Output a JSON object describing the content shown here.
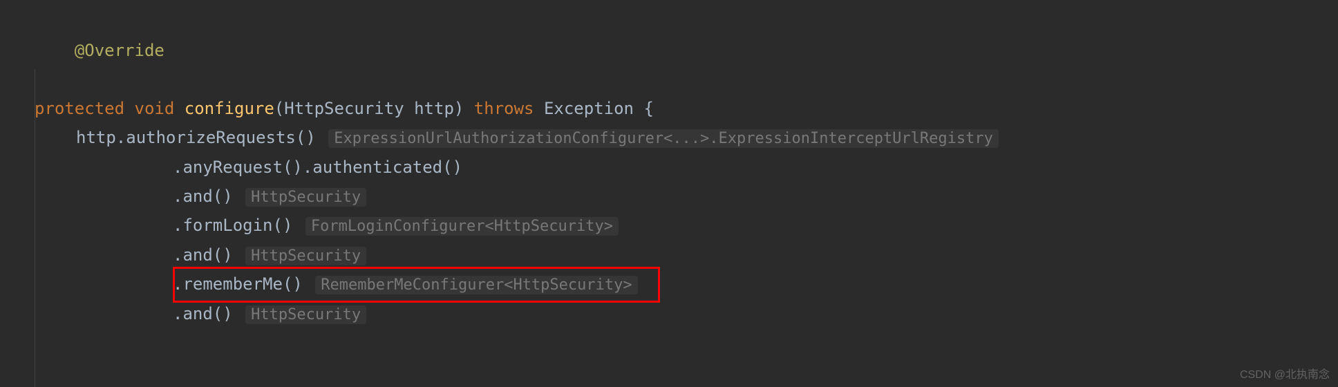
{
  "code": {
    "line1": {
      "annotation": "@Override"
    },
    "line2": {
      "kw_protected": "protected",
      "kw_void": "void",
      "method": "configure",
      "open_paren": "(",
      "param_type": "HttpSecurity",
      "param_name": "http",
      "close_paren": ")",
      "kw_throws": "throws",
      "exc_type": "Exception",
      "open_brace": "{"
    },
    "line3": {
      "text": "http.authorizeRequests()",
      "hint": "ExpressionUrlAuthorizationConfigurer<...>.ExpressionInterceptUrlRegistry"
    },
    "line4": {
      "text": ".anyRequest().authenticated()"
    },
    "line5": {
      "text": ".and()",
      "hint": "HttpSecurity"
    },
    "line6": {
      "text": ".formLogin()",
      "hint": "FormLoginConfigurer<HttpSecurity>"
    },
    "line7": {
      "text": ".and()",
      "hint": "HttpSecurity"
    },
    "line8": {
      "text": ".rememberMe()",
      "hint": "RememberMeConfigurer<HttpSecurity>"
    },
    "line9": {
      "text": ".and()",
      "hint": "HttpSecurity"
    }
  },
  "watermark": "CSDN @北执南念"
}
